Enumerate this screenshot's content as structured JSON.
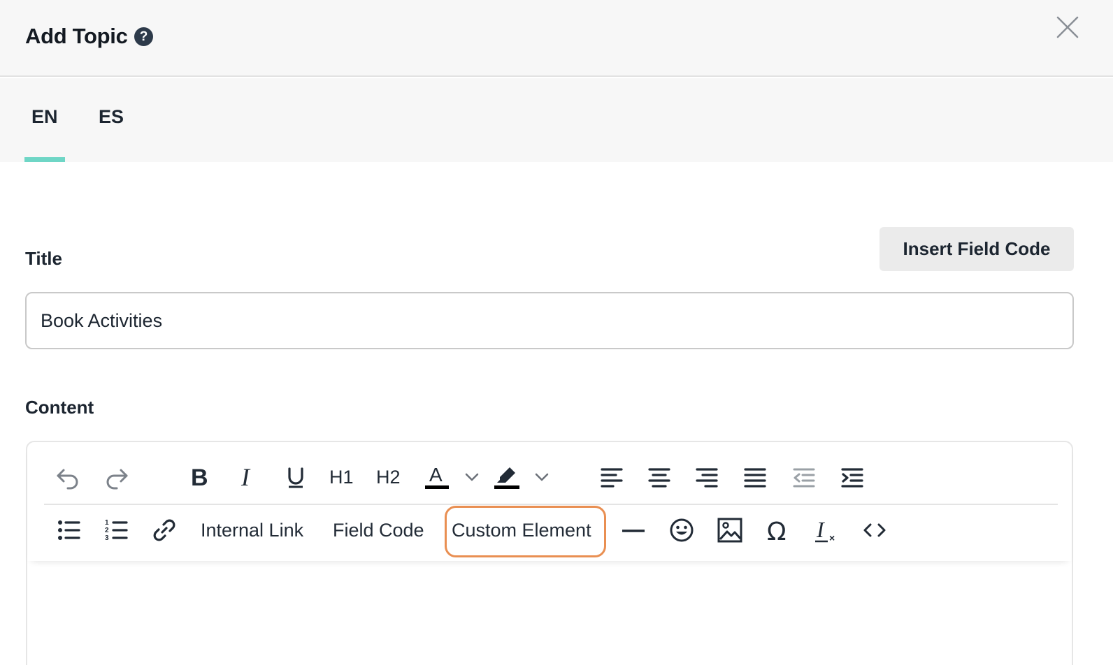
{
  "header": {
    "title": "Add Topic",
    "help_glyph": "?"
  },
  "tabs": [
    {
      "label": "EN",
      "active": true
    },
    {
      "label": "ES",
      "active": false
    }
  ],
  "form": {
    "title_label": "Title",
    "title_value": "Book Activities",
    "insert_field_code_label": "Insert Field Code",
    "content_label": "Content"
  },
  "editor": {
    "row1": [
      "undo-icon",
      "redo-icon",
      "bold-icon",
      "italic-icon",
      "underline-icon",
      "H1",
      "H2",
      "text-color-icon",
      "chevron-down-icon",
      "highlight-icon",
      "chevron-down-icon",
      "align-left-icon",
      "align-center-icon",
      "align-right-icon",
      "align-justify-icon",
      "outdent-icon",
      "indent-icon"
    ],
    "h1_label": "H1",
    "h2_label": "H2",
    "internal_link_label": "Internal Link",
    "field_code_label": "Field Code",
    "custom_element_label": "Custom Element",
    "row2": [
      "bullet-list-icon",
      "numbered-list-icon",
      "link-icon",
      "Internal Link",
      "Field Code",
      "Custom Element",
      "horizontal-rule-icon",
      "emoji-icon",
      "image-icon",
      "omega-icon",
      "clear-format-icon",
      "code-icon"
    ]
  },
  "colors": {
    "tab_accent": "#6fd6c6",
    "highlight_outline": "#e98f52",
    "text_color_bar": "#000000"
  }
}
